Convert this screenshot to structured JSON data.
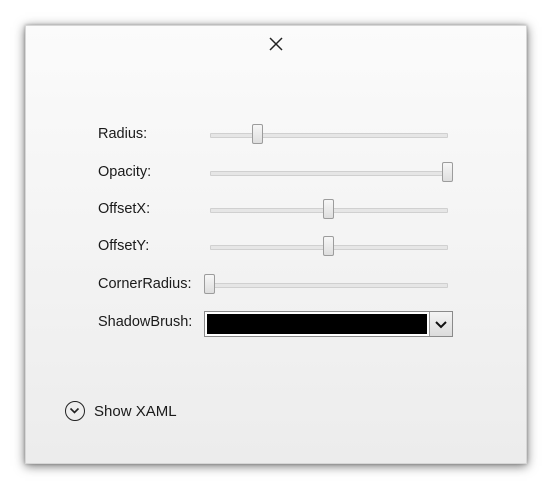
{
  "close_icon": "close-icon",
  "properties": [
    {
      "label": "Radius:",
      "value": 0.2
    },
    {
      "label": "Opacity:",
      "value": 1.0
    },
    {
      "label": "OffsetX:",
      "value": 0.5
    },
    {
      "label": "OffsetY:",
      "value": 0.5
    },
    {
      "label": "CornerRadius:",
      "value": 0.0
    }
  ],
  "shadow_brush": {
    "label": "ShadowBrush:",
    "color": "#000000"
  },
  "show_xaml": {
    "label": "Show XAML",
    "icon": "chevron-down-circle-icon"
  }
}
